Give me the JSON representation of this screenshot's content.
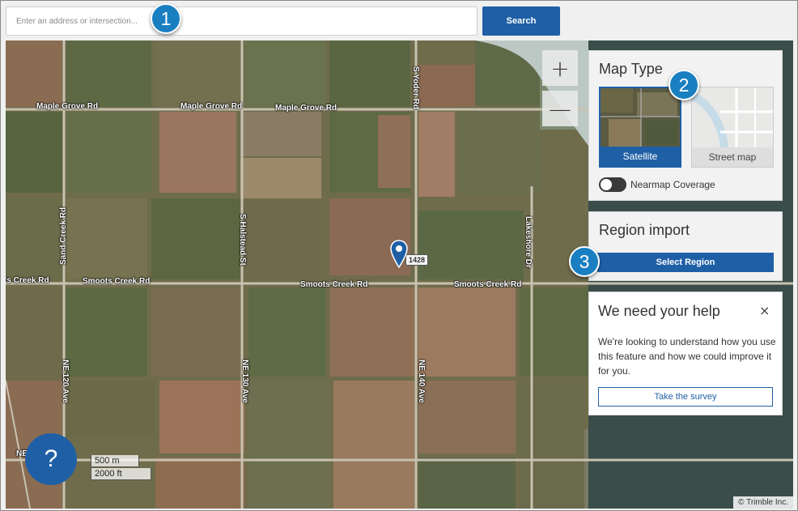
{
  "search": {
    "placeholder": "Enter an address or intersection...",
    "button_label": "Search"
  },
  "badges": [
    "1",
    "2",
    "3"
  ],
  "map": {
    "roads": {
      "maple_grove_1": "Maple Grove Rd",
      "maple_grove_2": "Maple Grove Rd",
      "maple_grove_3": "Maple Grove Rd",
      "smoots_1": "ts Creek Rd",
      "smoots_2": "Smoots Creek Rd",
      "smoots_3": "Smoots Creek Rd",
      "smoots_4": "Smoots Creek Rd",
      "sand_creek": "Sand Creek Rd",
      "halstead": "S Halstead St",
      "yoder": "S Yoder Rd",
      "lakeshore": "Lakeshore Dr",
      "ne120": "NE 120 Ave",
      "ne130": "NE 130 Ave",
      "ne140": "NE 140 Ave",
      "ne_partial": "NE"
    },
    "route_shield": "1428",
    "zoom_in": "+",
    "zoom_out": "—",
    "help_button": "?",
    "scale_metric": "500 m",
    "scale_imperial": "2000 ft",
    "copyright": "© Trimble Inc."
  },
  "map_type": {
    "title": "Map Type",
    "options": [
      {
        "label": "Satellite",
        "selected": true
      },
      {
        "label": "Street map",
        "selected": false
      }
    ],
    "coverage_toggle_label": "Nearmap Coverage",
    "coverage_enabled": false
  },
  "region_import": {
    "title": "Region import",
    "button_label": "Select Region"
  },
  "survey": {
    "title": "We need your help",
    "close": "×",
    "text": "We're looking to understand how you use this feature and how we could improve it for you.",
    "button_label": "Take the survey"
  },
  "colors": {
    "primary": "#1f5fa6",
    "badge": "#1a7fc1"
  }
}
